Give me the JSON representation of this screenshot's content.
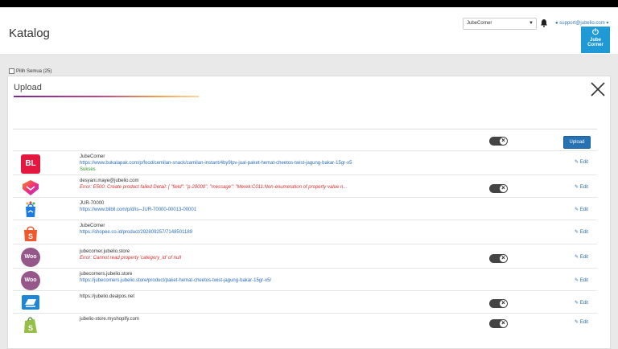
{
  "header": {
    "title": "Katalog",
    "store": "JubeCorner",
    "user_email": "support@jubelio.com",
    "logo_text_1": "Jube",
    "logo_text_2": "Corner"
  },
  "select_all": {
    "label": "Pilih Semua (25)"
  },
  "modal": {
    "title": "Upload",
    "upload_label": "Upload",
    "close_label": "×"
  },
  "rows": [
    {
      "channel": "Bukalapak",
      "icon_text": "BL",
      "name": "JubeCorner",
      "link": "https://www.bukalapak.com/p/food/cemilan-snack/camilan-instant/4by9lpv-jual-paket-hemat-cheetos-twist-jagung-bakar-15gr-x5",
      "status": "Sukses",
      "edit": "Edit"
    },
    {
      "channel": "Lazada",
      "name": "desyani.maye@jubelio.com",
      "error": "Error: E500: Create product failed Detail: [ \"field\": \"p-20000\", \"message\": \"Merek:C011:Non-enumeration of property value n...",
      "edit": "Edit"
    },
    {
      "channel": "Blibli",
      "name": "JUR-70000",
      "link": "https://www.blibli.com/p/d/is--JUR-70000-00013-00001",
      "edit": "Edit"
    },
    {
      "channel": "Shopee",
      "name": "JubeCorner",
      "link": "https://shopee.co.id/product/292809257/7148501189",
      "edit": "Edit"
    },
    {
      "channel": "WooCommerce",
      "icon_text": "Woo",
      "name": "jubecorner.jubelio.store",
      "error": "Error: Cannot read property 'category_id' of null",
      "edit": "Edit"
    },
    {
      "channel": "WooCommerce",
      "icon_text": "Woo",
      "name": "jubecorners.jubelio.store",
      "link": "https://jubecorners.jubelio.store/product/paket-hemat-cheetos-twist-jagung-bakar-15gr-x5/",
      "edit": "Edit"
    },
    {
      "channel": "Dealpos",
      "name": "https://jubelio.dealpos.net",
      "edit": "Edit"
    },
    {
      "channel": "Shopify",
      "name": "jubelio-store.myshopify.com",
      "edit": "Edit"
    }
  ]
}
